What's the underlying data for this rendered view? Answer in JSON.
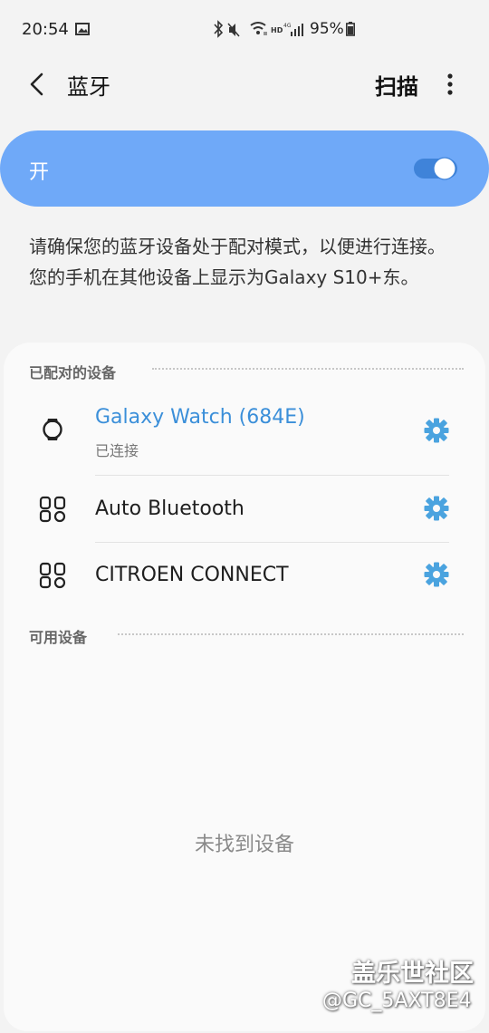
{
  "status_bar": {
    "time": "20:54",
    "battery": "95%",
    "icons": [
      "image-icon",
      "bluetooth-icon",
      "mute-icon",
      "wifi-icon",
      "hd-icon",
      "signal-icon",
      "battery-icon"
    ]
  },
  "header": {
    "title": "蓝牙",
    "scan_label": "扫描"
  },
  "toggle": {
    "label": "开",
    "state": "on",
    "accent": "#6fa9f8"
  },
  "description": "请确保您的蓝牙设备处于配对模式，以便进行连接。 您的手机在其他设备上显示为Galaxy S10+东。",
  "paired": {
    "header": "已配对的设备",
    "devices": [
      {
        "name": "Galaxy Watch (684E)",
        "status": "已连接",
        "icon": "watch-icon"
      },
      {
        "name": "Auto Bluetooth",
        "status": "",
        "icon": "generic-device-icon"
      },
      {
        "name": "CITROEN CONNECT",
        "status": "",
        "icon": "generic-device-icon"
      }
    ]
  },
  "available": {
    "header": "可用设备",
    "empty_text": "未找到设备"
  },
  "watermark": {
    "line1": "盖乐世社区",
    "line2": "@GC_5AXT8E4"
  },
  "colors": {
    "connected": "#3b8fd9",
    "gear": "#4aa3df"
  }
}
